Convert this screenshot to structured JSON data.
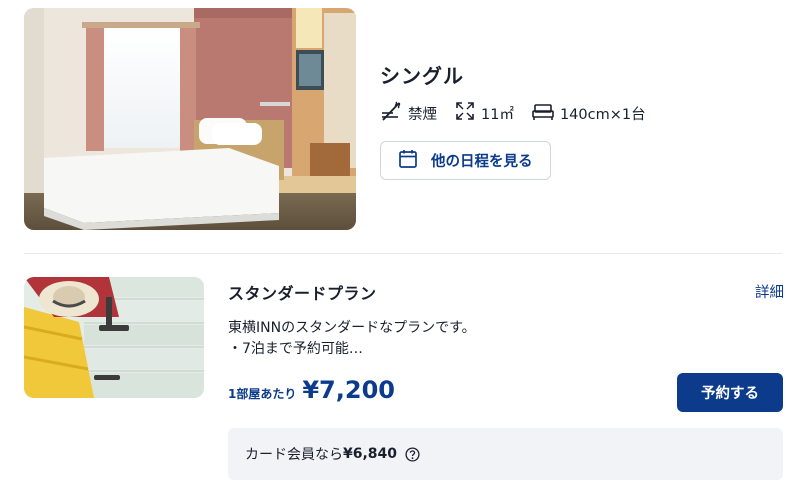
{
  "room": {
    "name": "シングル",
    "smoking": "禁煙",
    "area": "11㎡",
    "bed": "140cm×1台",
    "dates_button_label": "他の日程を見る"
  },
  "plan": {
    "name": "スタンダードプラン",
    "details_link": "詳細",
    "description_line1": "東横INNのスタンダードなプランです。",
    "description_line2": "・7泊まで予約可能…",
    "price_label": "1部屋あたり",
    "price": "¥7,200",
    "reserve_button_label": "予約する",
    "member_price_prefix": "カード会員なら",
    "member_price": "¥6,840"
  },
  "colors": {
    "brand": "#0c3b8c",
    "text": "#1a1f2e",
    "muted_bg": "#f1f3f6",
    "border": "#cfd6e0"
  },
  "icons": {
    "smoking": "no-smoking-icon",
    "area": "room-area-icon",
    "bed": "bed-icon",
    "calendar": "calendar-icon",
    "help": "help-circle-icon"
  }
}
